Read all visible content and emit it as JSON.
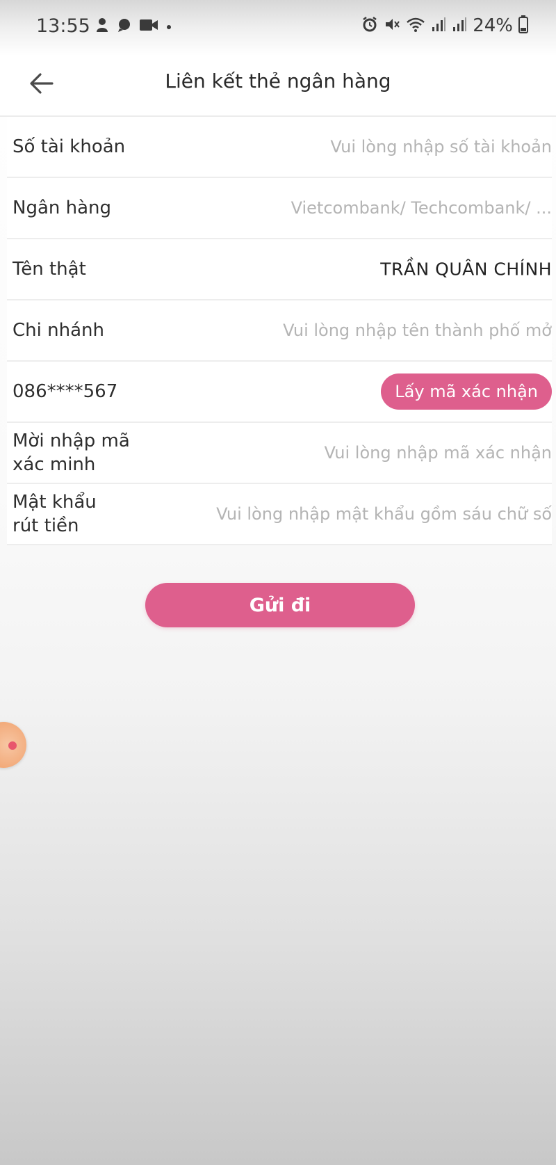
{
  "status_bar": {
    "time": "13:55",
    "battery": "24%",
    "left_icons": [
      "notification-icon",
      "chat-icon",
      "video-record-icon",
      "dot-icon"
    ],
    "right_icons": [
      "alarm-icon",
      "mute-icon",
      "wifi-icon",
      "signal-icon",
      "signal-icon",
      "battery-icon"
    ]
  },
  "header": {
    "title": "Liên kết thẻ ngân hàng",
    "back_icon": "arrow-left-icon"
  },
  "form": {
    "account_number": {
      "label": "Số tài khoản",
      "placeholder": "Vui lòng nhập số tài khoản",
      "value": ""
    },
    "bank": {
      "label": "Ngân hàng",
      "placeholder": "Vietcombank/ Techcombank/ ...",
      "value": ""
    },
    "real_name": {
      "label": "Tên thật",
      "value": "TRẦN QUÂN CHÍNH"
    },
    "branch": {
      "label": "Chi nhánh",
      "placeholder": "Vui lòng nhập tên thành phố mở",
      "value": ""
    },
    "phone": {
      "label": "086****567",
      "otp_button": "Lấy mã xác nhận"
    },
    "verification_code": {
      "label": "Mời nhập mã\nxác minh",
      "placeholder": "Vui lòng nhập mã xác nhận",
      "value": ""
    },
    "withdraw_password": {
      "label": "Mật khẩu\nrút tiền",
      "placeholder": "Vui lòng nhập mật khẩu gồm sáu chữ số",
      "value": ""
    }
  },
  "submit_label": "Gửi đi",
  "colors": {
    "accent": "#de5f8d",
    "placeholder": "#b4b4b4",
    "divider": "#ededed"
  }
}
